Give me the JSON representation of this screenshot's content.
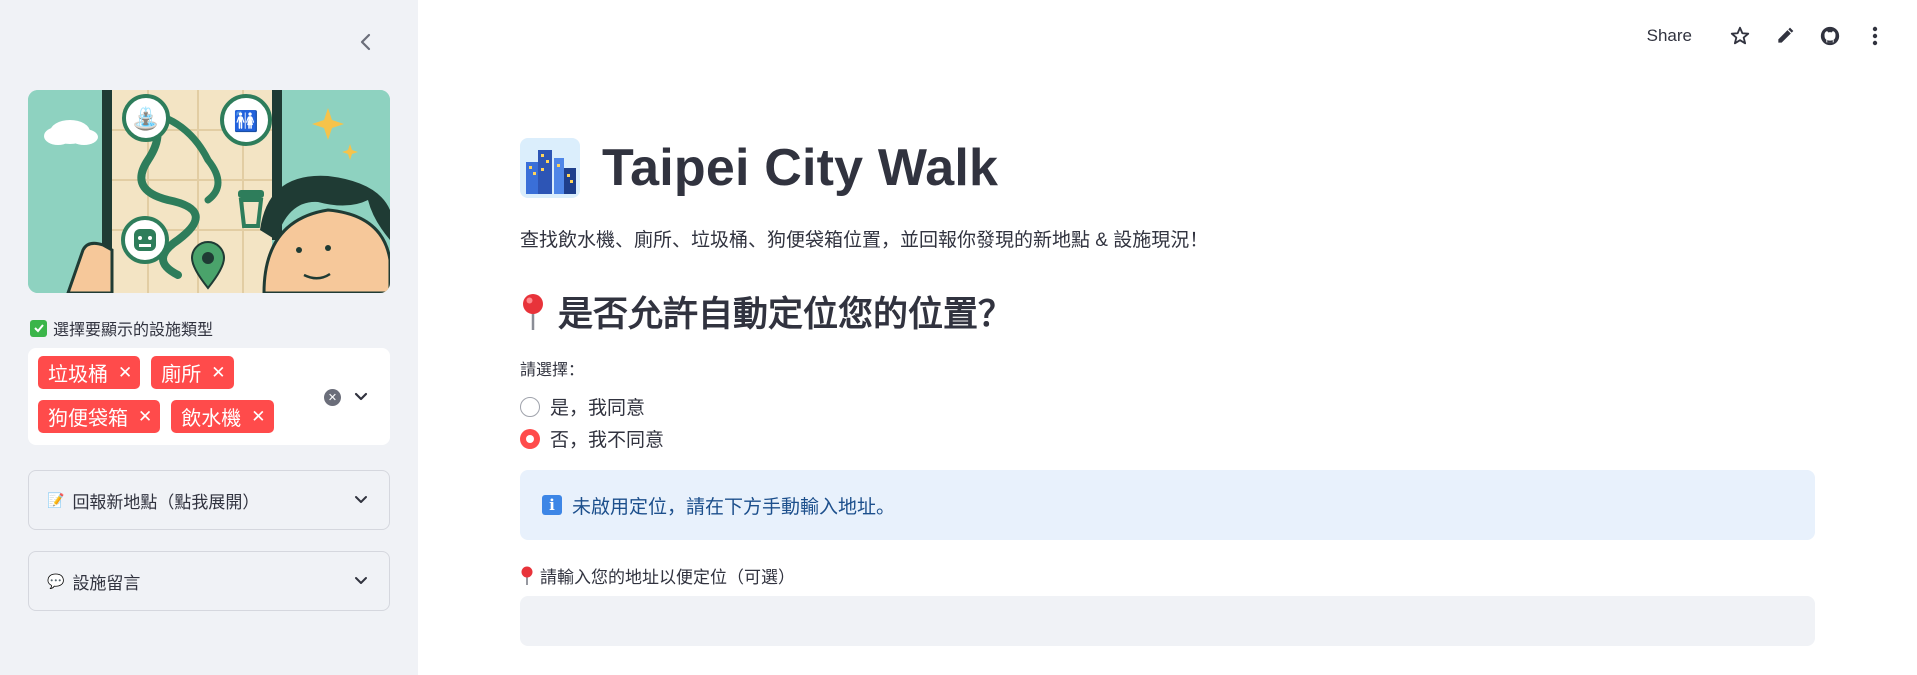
{
  "sidebar": {
    "facility_label": "選擇要顯示的設施類型",
    "selected_tags": [
      {
        "label": "垃圾桶"
      },
      {
        "label": "廁所"
      },
      {
        "label": "狗便袋箱"
      },
      {
        "label": "飲水機"
      }
    ],
    "expanders": [
      {
        "label": "回報新地點（點我展開）",
        "icon": "memo-icon"
      },
      {
        "label": "設施留言",
        "icon": "speech-bubble-icon"
      }
    ]
  },
  "toolbar": {
    "share_label": "Share",
    "icons": [
      "star-icon",
      "pencil-icon",
      "github-icon",
      "more-vert-icon"
    ]
  },
  "main": {
    "title": "Taipei City Walk",
    "subtitle": "查找飲水機、廁所、垃圾桶、狗便袋箱位置，並回報你發現的新地點 & 設施現況！",
    "location_heading": "是否允許自動定位您的位置？",
    "radio_label": "請選擇：",
    "radio_options": [
      {
        "label": "是，我同意",
        "selected": false
      },
      {
        "label": "否，我不同意",
        "selected": true
      }
    ],
    "info_message": "未啟用定位，請在下方手動輸入地址。",
    "address_label": "請輸入您的地址以便定位（可選）",
    "address_value": "",
    "address_placeholder": ""
  },
  "colors": {
    "primary": "#ff4b4b",
    "sidebar_bg": "#f0f2f6",
    "info_bg": "#e8f1fc",
    "info_text": "#1c4f8c",
    "text": "#31333f"
  }
}
